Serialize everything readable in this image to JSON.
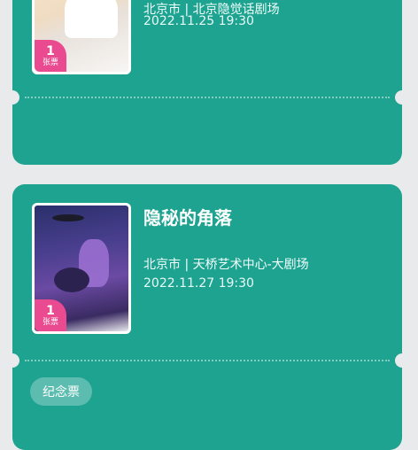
{
  "orders": [
    {
      "title": "",
      "venue": "北京市 | 北京隐觉话剧场",
      "time": "2022.11.25 19:30",
      "ticket_count": "1",
      "ticket_unit": "张票"
    },
    {
      "title": "隐秘的角落",
      "venue": "北京市 | 天桥艺术中心-大剧场",
      "time": "2022.11.27 19:30",
      "ticket_count": "1",
      "ticket_unit": "张票",
      "tag": "纪念票"
    }
  ],
  "colors": {
    "card": "#1ea391",
    "badge": "#ea4a8f",
    "background": "#e9eaec"
  }
}
